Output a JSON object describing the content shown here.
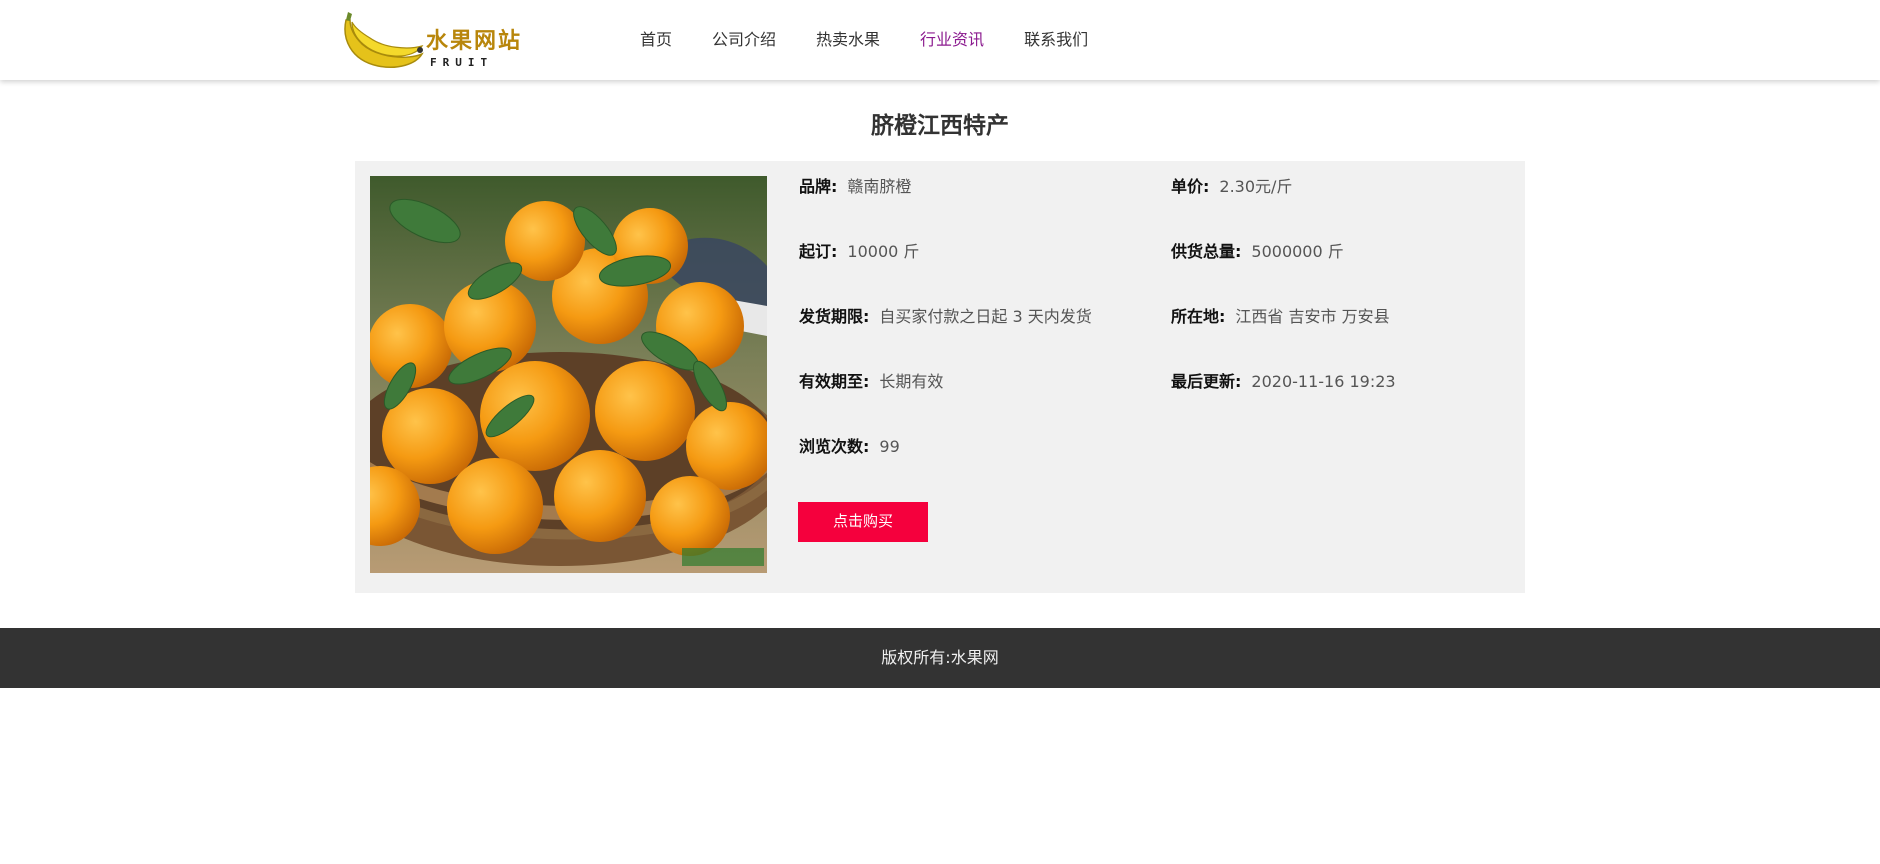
{
  "header": {
    "logo": {
      "text": "水果网站",
      "subtext": "FRUIT"
    },
    "nav": [
      {
        "label": "首页",
        "active": false
      },
      {
        "label": "公司介绍",
        "active": false
      },
      {
        "label": "热卖水果",
        "active": false
      },
      {
        "label": "行业资讯",
        "active": true
      },
      {
        "label": "联系我们",
        "active": false
      }
    ]
  },
  "product": {
    "title": "脐橙江西特产",
    "image_alt": "navel oranges in woven basket",
    "fields": {
      "brand": {
        "key": "品牌:",
        "value": "赣南脐橙"
      },
      "price": {
        "key": "单价:",
        "value": "2.30元/斤"
      },
      "min_order": {
        "key": "起订:",
        "value": "10000 斤"
      },
      "supply": {
        "key": "供货总量:",
        "value": "5000000 斤"
      },
      "delivery": {
        "key": "发货期限:",
        "value": "自买家付款之日起 3 天内发货"
      },
      "location": {
        "key": "所在地:",
        "value": "江西省 吉安市 万安县"
      },
      "valid_until": {
        "key": "有效期至:",
        "value": "长期有效"
      },
      "updated": {
        "key": "最后更新:",
        "value": "2020-11-16 19:23"
      },
      "views": {
        "key": "浏览次数:",
        "value": "99"
      }
    },
    "buy_label": "点击购买"
  },
  "footer": {
    "copyright": "版权所有:水果网"
  },
  "colors": {
    "accent_nav": "#8b1a8f",
    "buy_button": "#f5003d",
    "footer_bg": "#333333",
    "panel_bg": "#f1f1f1"
  }
}
